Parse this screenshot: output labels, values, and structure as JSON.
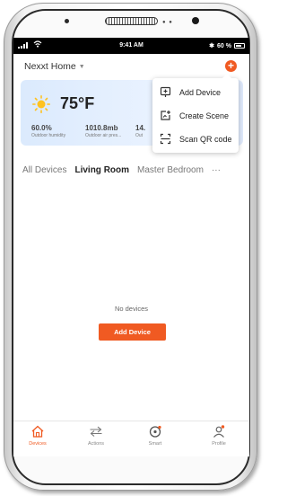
{
  "status_bar": {
    "time": "9:41 AM",
    "battery": "60 %"
  },
  "header": {
    "home_name": "Nexxt Home"
  },
  "weather": {
    "temperature": "75°F",
    "stats": [
      {
        "value": "60.0%",
        "label": "Outdoor humidity"
      },
      {
        "value": "1010.8mb",
        "label": "Outdoor air pres..."
      },
      {
        "value": "14.",
        "label": "Out"
      }
    ]
  },
  "menu": {
    "items": [
      {
        "label": "Add Device",
        "icon": "add-device-icon"
      },
      {
        "label": "Create Scene",
        "icon": "create-scene-icon"
      },
      {
        "label": "Scan QR code",
        "icon": "scan-qr-icon"
      }
    ]
  },
  "rooms": {
    "tabs": [
      "All Devices",
      "Living Room",
      "Master Bedroom"
    ],
    "active": "Living Room",
    "more": "···"
  },
  "empty_state": {
    "message": "No devices",
    "button": "Add Device"
  },
  "bottom_nav": {
    "items": [
      {
        "label": "Devices",
        "icon": "home-icon",
        "active": true
      },
      {
        "label": "Actions",
        "icon": "arrows-icon",
        "active": false
      },
      {
        "label": "Smart",
        "icon": "smart-icon",
        "active": false
      },
      {
        "label": "Profile",
        "icon": "profile-icon",
        "active": false
      }
    ]
  },
  "colors": {
    "accent": "#f05a22",
    "weather_bg": "#e4effd"
  }
}
